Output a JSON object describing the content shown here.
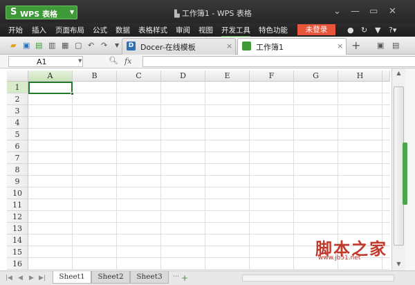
{
  "app": {
    "logo_letter": "S",
    "name": "WPS 表格",
    "window_title": "工作簿1 - WPS 表格"
  },
  "menu": {
    "items": [
      "开始",
      "插入",
      "页面布局",
      "公式",
      "数据",
      "表格样式",
      "审阅",
      "视图",
      "开发工具",
      "特色功能"
    ],
    "active": "开发工具",
    "login_label": "未登录"
  },
  "tabs": {
    "docer_label": "Docer-在线模板",
    "workbook_label": "工作簿1",
    "close_glyph": "×",
    "new_tab_glyph": "+"
  },
  "formula_bar": {
    "name_box_value": "A1",
    "fx_label": "fx",
    "formula_value": ""
  },
  "sheet": {
    "columns": [
      "A",
      "B",
      "C",
      "D",
      "E",
      "F",
      "G",
      "H"
    ],
    "rows": [
      "1",
      "2",
      "3",
      "4",
      "5",
      "6",
      "7",
      "8",
      "9",
      "10",
      "11",
      "12",
      "13",
      "14",
      "15",
      "16"
    ],
    "selected_cell": "A1",
    "selected_column": "A",
    "selected_row": "1"
  },
  "sheet_tabs": {
    "items": [
      "Sheet1",
      "Sheet2",
      "Sheet3"
    ],
    "active": "Sheet1",
    "add_glyph": "+"
  },
  "watermark": {
    "main": "脚本之家",
    "url": "www.jb51.net"
  },
  "colors": {
    "accent_green": "#3e9a37",
    "login_red": "#e9553b",
    "titlebar_dark": "#262626"
  }
}
